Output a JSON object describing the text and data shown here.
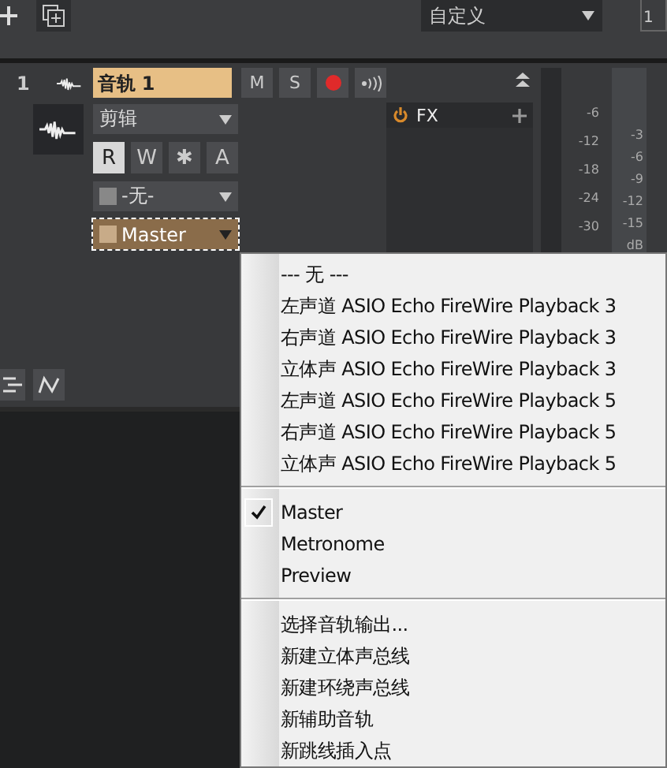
{
  "toolbar": {
    "preset": "自定义",
    "counter": "1"
  },
  "track": {
    "number": "1",
    "name": "音轨 1",
    "buttons": [
      {
        "kind": "text",
        "label": "M"
      },
      {
        "kind": "text",
        "label": "S"
      },
      {
        "kind": "record"
      },
      {
        "kind": "monitor"
      }
    ],
    "mode": "剪辑",
    "automation_buttons": [
      {
        "label": "R",
        "selected": true
      },
      {
        "label": "W",
        "selected": false
      },
      {
        "label": "✱",
        "selected": false
      },
      {
        "label": "A",
        "selected": false
      }
    ],
    "input": "-无-",
    "output": "Master",
    "fx": {
      "label": "FX"
    },
    "meter_scale": [
      "-6",
      "-12",
      "-18",
      "-24",
      "-30"
    ],
    "master_scale": [
      "-3",
      "-6",
      "-9",
      "-12",
      "-15",
      "dB"
    ]
  },
  "menu": {
    "sections": [
      [
        {
          "label": "--- 无 ---",
          "checked": false
        },
        {
          "label": "左声道  ASIO Echo FireWire Playback 3",
          "checked": false
        },
        {
          "label": "右声道  ASIO Echo FireWire Playback 3",
          "checked": false
        },
        {
          "label": "立体声 ASIO Echo FireWire Playback 3",
          "checked": false
        },
        {
          "label": "左声道  ASIO Echo FireWire Playback 5",
          "checked": false
        },
        {
          "label": "右声道  ASIO Echo FireWire Playback 5",
          "checked": false
        },
        {
          "label": "立体声 ASIO Echo FireWire Playback 5",
          "checked": false
        }
      ],
      [
        {
          "label": "Master",
          "checked": true
        },
        {
          "label": "Metronome",
          "checked": false
        },
        {
          "label": "Preview",
          "checked": false
        }
      ],
      [
        {
          "label": "选择音轨输出...",
          "checked": false
        },
        {
          "label": "新建立体声总线",
          "checked": false
        },
        {
          "label": "新建环绕声总线",
          "checked": false
        },
        {
          "label": "新辅助音轨",
          "checked": false
        },
        {
          "label": "新跳线插入点",
          "checked": false
        }
      ]
    ]
  }
}
